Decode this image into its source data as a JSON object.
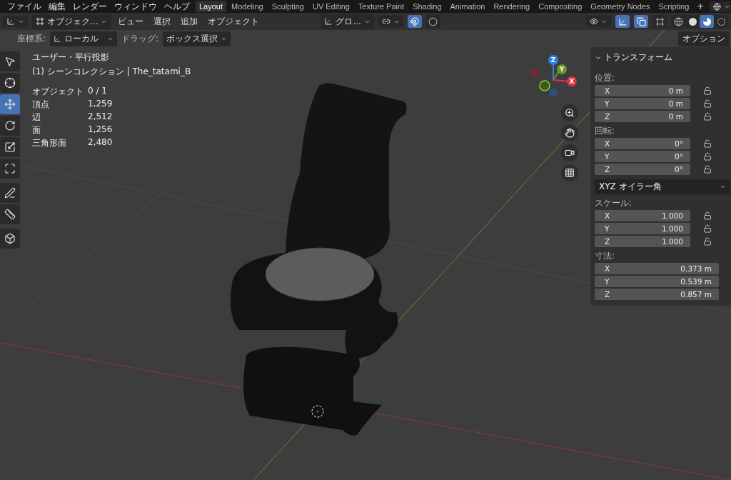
{
  "top_menu": [
    "ファイル",
    "編集",
    "レンダー",
    "ウィンドウ",
    "ヘルプ"
  ],
  "workspaces": [
    {
      "label": "Layout",
      "selected": true
    },
    {
      "label": "Modeling",
      "selected": false
    },
    {
      "label": "Sculpting",
      "selected": false
    },
    {
      "label": "UV Editing",
      "selected": false
    },
    {
      "label": "Texture Paint",
      "selected": false
    },
    {
      "label": "Shading",
      "selected": false
    },
    {
      "label": "Animation",
      "selected": false
    },
    {
      "label": "Rendering",
      "selected": false
    },
    {
      "label": "Compositing",
      "selected": false
    },
    {
      "label": "Geometry Nodes",
      "selected": false
    },
    {
      "label": "Scripting",
      "selected": false
    }
  ],
  "add_workspace": "+",
  "header": {
    "mode": "オブジェク...",
    "menus": [
      "ビュー",
      "選択",
      "追加",
      "オブジェクト"
    ],
    "orientation": "グロ..."
  },
  "header_toggles": [
    {
      "kind": "snap",
      "on": true
    },
    {
      "kind": "proportional",
      "on": false
    },
    {
      "kind": "gizmo",
      "on": true
    },
    {
      "kind": "overlay",
      "on": true
    },
    {
      "kind": "xray",
      "on": false
    }
  ],
  "shading_modes": [
    {
      "kind": "wireframe",
      "selected": false
    },
    {
      "kind": "solid",
      "selected": false
    },
    {
      "kind": "material",
      "selected": true
    },
    {
      "kind": "rendered",
      "selected": false
    }
  ],
  "tool_settings": {
    "orientation_label": "座標系:",
    "orientation": "ローカル",
    "drag_label": "ドラッグ:",
    "drag": "ボックス選択",
    "options": "オプション"
  },
  "tools": [
    {
      "kind": "select",
      "selected": false
    },
    {
      "kind": "cursor",
      "selected": false
    },
    {
      "kind": "move",
      "selected": true
    },
    {
      "kind": "rotate",
      "selected": false
    },
    {
      "kind": "scale",
      "selected": false
    },
    {
      "kind": "transform",
      "selected": false
    },
    {
      "kind": "annotate",
      "selected": false
    },
    {
      "kind": "measure",
      "selected": false
    },
    {
      "kind": "add_cube",
      "selected": false
    }
  ],
  "viewport_info": {
    "view": "ユーザー・平行投影",
    "collection": "(1) シーンコレクション | The_tatami_B",
    "stats": [
      {
        "label": "オブジェクト",
        "value": "0 / 1"
      },
      {
        "label": "頂点",
        "value": "1,259"
      },
      {
        "label": "辺",
        "value": "2,512"
      },
      {
        "label": "面",
        "value": "1,256"
      },
      {
        "label": "三角形面",
        "value": "2,480"
      }
    ]
  },
  "gizmo_axes": [
    {
      "label": "Z",
      "color": "#2f7fe0"
    },
    {
      "label": "Y",
      "color": "#6a9a1f"
    },
    {
      "label": "X",
      "color": "#e0334a"
    }
  ],
  "transform_panel": {
    "title": "トランスフォーム",
    "rotation_mode": "XYZ オイラー角",
    "groups": [
      {
        "label": "位置:",
        "fields": [
          {
            "axis": "X",
            "value": "0 m",
            "locked": false
          },
          {
            "axis": "Y",
            "value": "0 m",
            "locked": false
          },
          {
            "axis": "Z",
            "value": "0 m",
            "locked": false
          }
        ]
      },
      {
        "label": "回転:",
        "fields": [
          {
            "axis": "X",
            "value": "0°",
            "locked": false
          },
          {
            "axis": "Y",
            "value": "0°",
            "locked": false
          },
          {
            "axis": "Z",
            "value": "0°",
            "locked": false
          }
        ]
      },
      {
        "label": "スケール:",
        "fields": [
          {
            "axis": "X",
            "value": "1.000",
            "locked": false
          },
          {
            "axis": "Y",
            "value": "1.000",
            "locked": false
          },
          {
            "axis": "Z",
            "value": "1.000",
            "locked": false
          }
        ]
      },
      {
        "label": "寸法:",
        "fields": [
          {
            "axis": "X",
            "value": "0.373 m"
          },
          {
            "axis": "Y",
            "value": "0.539 m"
          },
          {
            "axis": "Z",
            "value": "0.857 m"
          }
        ]
      }
    ]
  }
}
